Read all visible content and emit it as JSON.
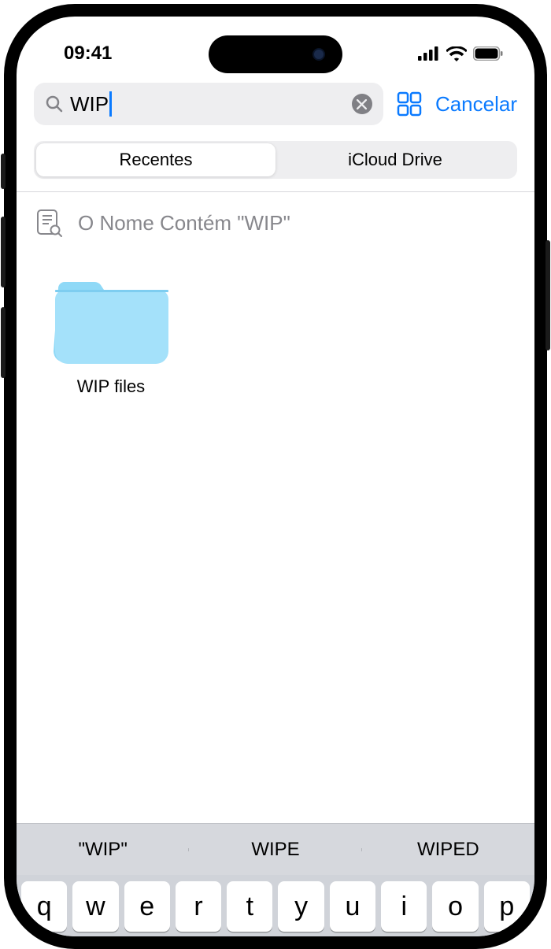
{
  "status": {
    "time": "09:41"
  },
  "search": {
    "value": "WIP",
    "cancel_label": "Cancelar"
  },
  "segments": {
    "recents": "Recentes",
    "icloud": "iCloud Drive"
  },
  "filter": {
    "text": "O Nome Contém \"WIP\""
  },
  "results": [
    {
      "name": "WIP files"
    }
  ],
  "suggestions": {
    "s1": "\"WIP\"",
    "s2": "WIPE",
    "s3": "WIPED"
  },
  "keys": {
    "k0": "q",
    "k1": "w",
    "k2": "e",
    "k3": "r",
    "k4": "t",
    "k5": "y",
    "k6": "u",
    "k7": "i",
    "k8": "o",
    "k9": "p"
  }
}
